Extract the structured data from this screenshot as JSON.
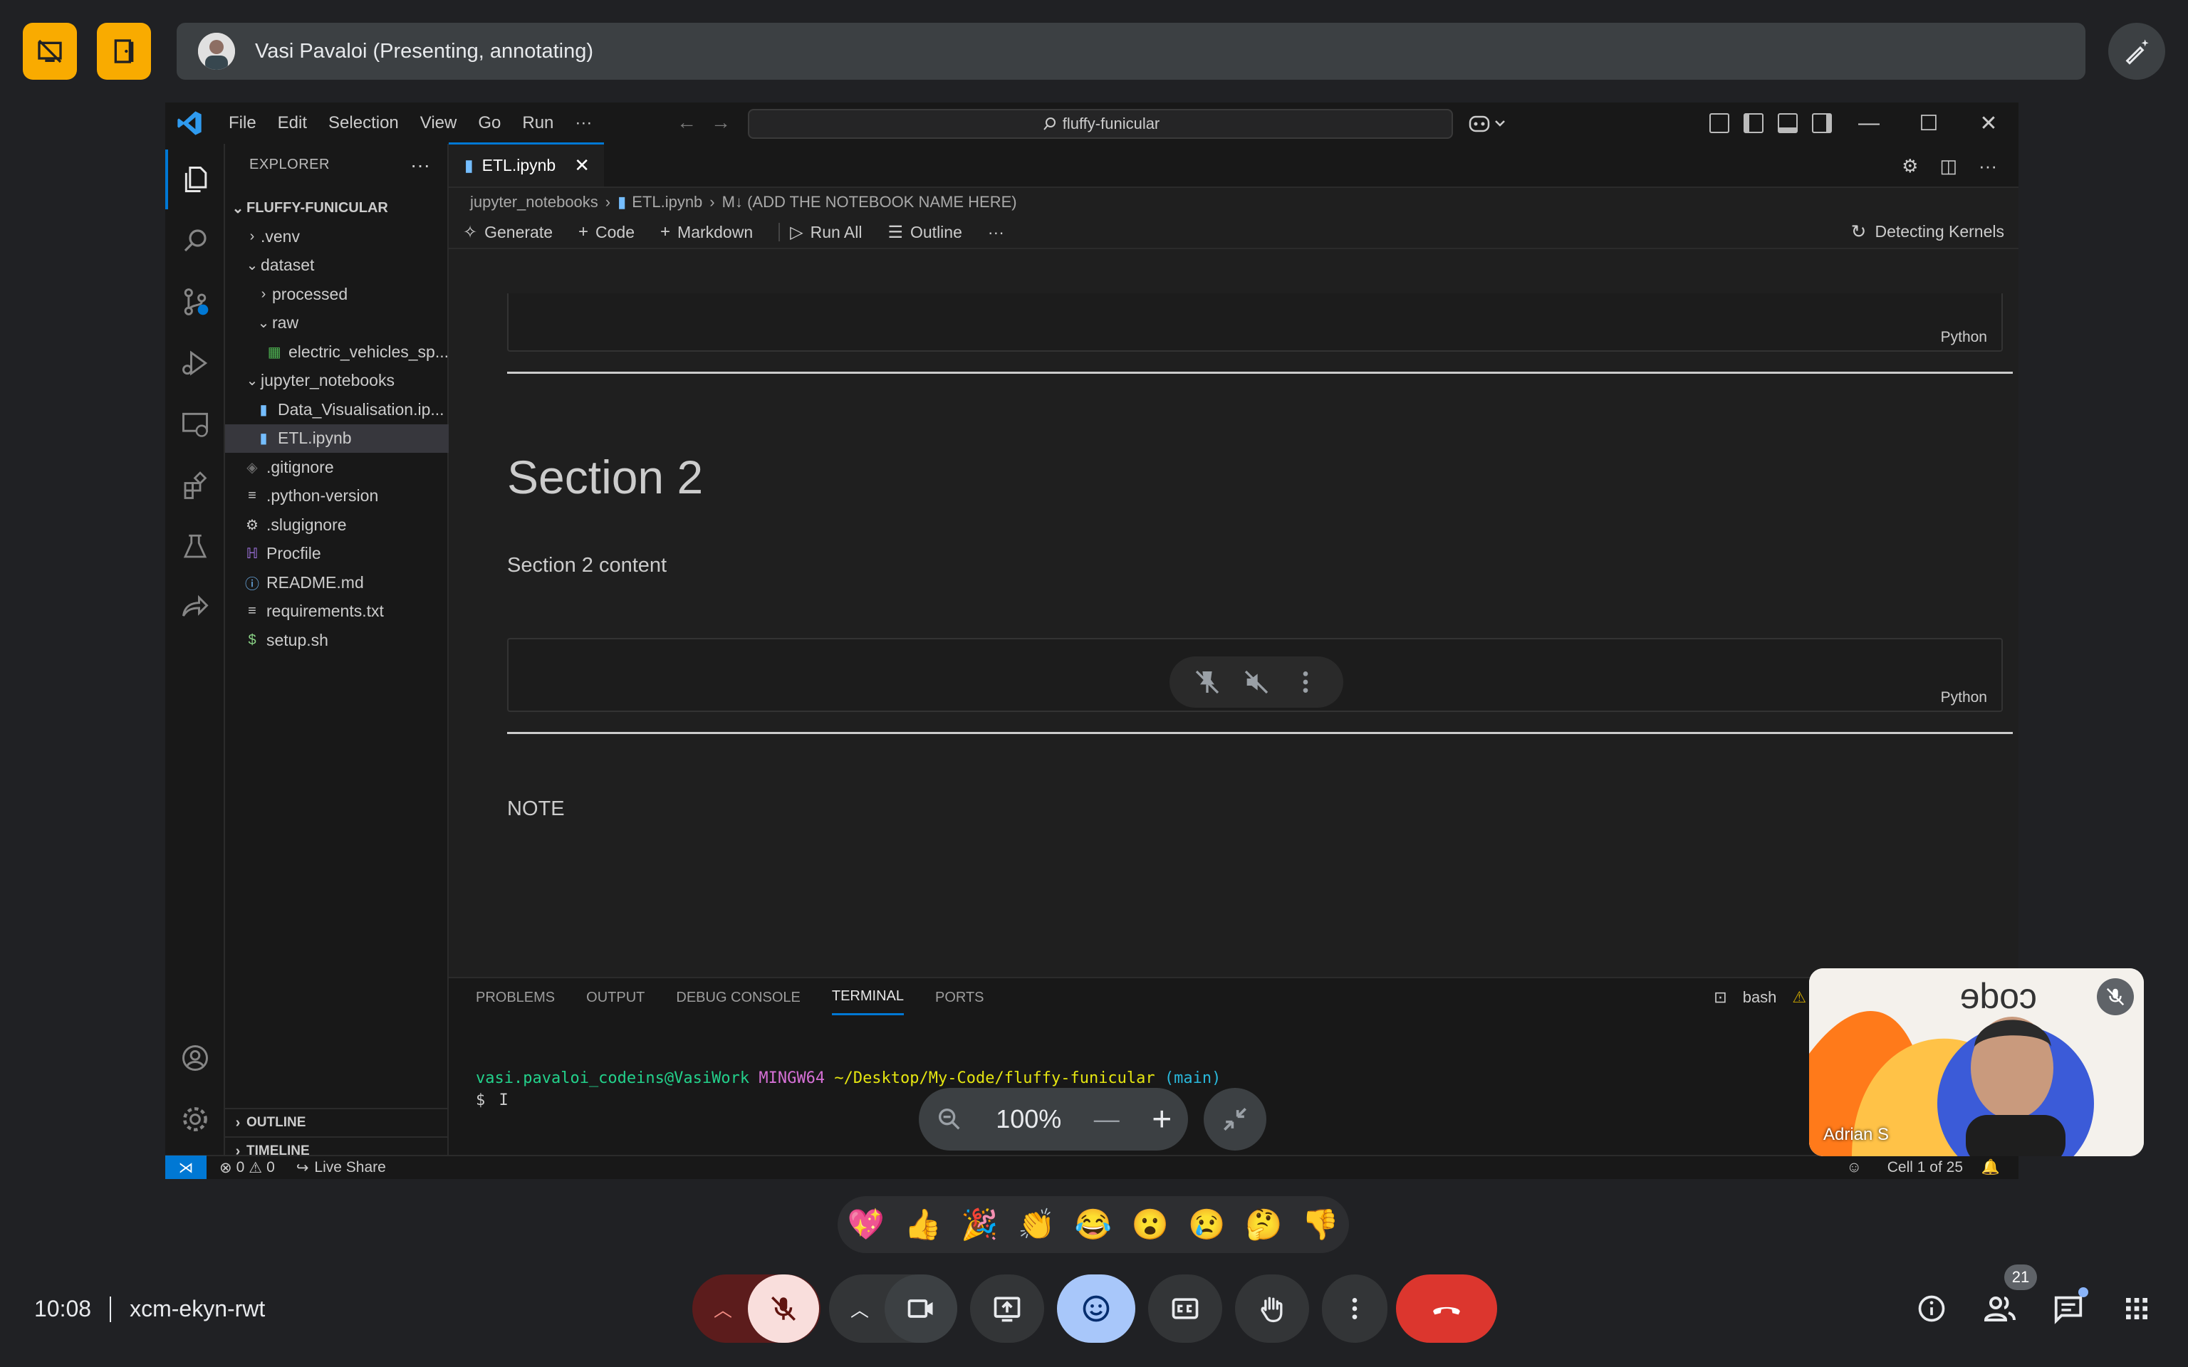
{
  "meet": {
    "presenter_name": "Vasi Pavaloi (Presenting, annotating)",
    "time": "10:08",
    "meeting_code": "xcm-ekyn-rwt",
    "participants_count": "21",
    "zoom_level": "100%",
    "self_view_name": "Adrian S",
    "reactions": [
      "💖",
      "👍",
      "🎉",
      "👏",
      "😂",
      "😮",
      "😢",
      "🤔",
      "👎"
    ],
    "colors": {
      "accent_yellow": "#f9ab00",
      "end_call_red": "#ea4335",
      "reactions_blue": "#8ab4f8",
      "mic_off_bg": "#f28b82"
    }
  },
  "vscode": {
    "menu": [
      "File",
      "Edit",
      "Selection",
      "View",
      "Go",
      "Run",
      "···"
    ],
    "search": "fluffy-funicular",
    "explorer_title": "EXPLORER",
    "workspace": "FLUFFY-FUNICULAR",
    "tree": [
      {
        "label": ".venv",
        "indent": 1,
        "type": "folder",
        "open": false
      },
      {
        "label": "dataset",
        "indent": 1,
        "type": "folder",
        "open": true
      },
      {
        "label": "processed",
        "indent": 2,
        "type": "folder",
        "open": false
      },
      {
        "label": "raw",
        "indent": 2,
        "type": "folder",
        "open": true
      },
      {
        "label": "electric_vehicles_sp...",
        "indent": 3,
        "type": "csv"
      },
      {
        "label": "jupyter_notebooks",
        "indent": 1,
        "type": "folder",
        "open": true
      },
      {
        "label": "Data_Visualisation.ip...",
        "indent": 2,
        "type": "notebook"
      },
      {
        "label": "ETL.ipynb",
        "indent": 2,
        "type": "notebook",
        "selected": true
      },
      {
        "label": ".gitignore",
        "indent": 1,
        "type": "git"
      },
      {
        "label": ".python-version",
        "indent": 1,
        "type": "text"
      },
      {
        "label": ".slugignore",
        "indent": 1,
        "type": "gear"
      },
      {
        "label": "Procfile",
        "indent": 1,
        "type": "heroku"
      },
      {
        "label": "README.md",
        "indent": 1,
        "type": "info"
      },
      {
        "label": "requirements.txt",
        "indent": 1,
        "type": "text"
      },
      {
        "label": "setup.sh",
        "indent": 1,
        "type": "shell"
      }
    ],
    "outline": "OUTLINE",
    "timeline": "TIMELINE",
    "tab": "ETL.ipynb",
    "breadcrumb": [
      "jupyter_notebooks",
      "ETL.ipynb",
      "M↓ (ADD THE NOTEBOOK NAME HERE)"
    ],
    "toolbar": {
      "generate": "Generate",
      "code": "Code",
      "markdown": "Markdown",
      "run_all": "Run All",
      "outline": "Outline",
      "more": "···"
    },
    "kernel": "Detecting Kernels",
    "cell_lang": "Python",
    "section_title": "Section 2",
    "section_content": "Section 2 content",
    "note": "NOTE",
    "panel_tabs": [
      "PROBLEMS",
      "OUTPUT",
      "DEBUG CONSOLE",
      "TERMINAL",
      "PORTS"
    ],
    "shell": "bash",
    "terminal": {
      "user": "vasi.pavaloi_codeins@VasiWork",
      "env": "MINGW64",
      "path": "~/Desktop/My-Code/fluffy-funicular",
      "branch": "(main)",
      "prompt": "$"
    },
    "status": {
      "errors": "0",
      "warnings": "0",
      "live_share": "Live Share",
      "cell": "Cell 1 of 25"
    }
  }
}
